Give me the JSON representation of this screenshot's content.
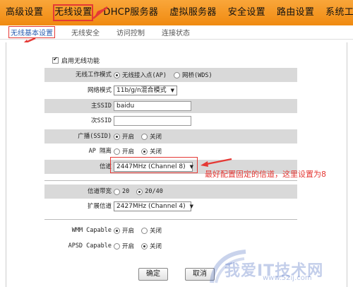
{
  "topnav": {
    "items": [
      "高级设置",
      "无线设置",
      "DHCP服务器",
      "虚拟服务器",
      "安全设置",
      "路由设置",
      "系统工具"
    ]
  },
  "subnav": {
    "tabs": [
      "无线基本设置",
      "无线安全",
      "访问控制",
      "连接状态"
    ]
  },
  "form": {
    "enable_wireless_label": "启用无线功能",
    "enable_wireless_checked": true,
    "mode": {
      "label": "无线工作模式",
      "options": [
        "无线接入点(AP)",
        "网桥(WDS)"
      ],
      "selected": "无线接入点(AP)"
    },
    "network_mode": {
      "label": "网络模式",
      "value": "11b/g/n混合模式"
    },
    "primary_ssid": {
      "label": "主SSID",
      "value": "baidu"
    },
    "secondary_ssid": {
      "label": "次SSID",
      "value": ""
    },
    "broadcast": {
      "label": "广播(SSID)",
      "options": [
        "开启",
        "关闭"
      ],
      "selected": "开启"
    },
    "ap_isolation": {
      "label": "AP 隔离",
      "options": [
        "开启",
        "关闭"
      ],
      "selected": "关闭"
    },
    "channel": {
      "label": "信道",
      "value": "2447MHz (Channel 8)"
    },
    "bandwidth": {
      "label": "信道带宽",
      "options": [
        "20",
        "20/40"
      ],
      "selected": "20/40"
    },
    "ext_channel": {
      "label": "扩展信道",
      "value": "2427MHz (Channel 4)"
    },
    "wmm": {
      "label": "WMM Capable",
      "options": [
        "开启",
        "关闭"
      ],
      "selected": "开启"
    },
    "apsd": {
      "label": "APSD Capable",
      "options": [
        "开启",
        "关闭"
      ],
      "selected": "关闭"
    }
  },
  "buttons": {
    "ok": "确定",
    "cancel": "取消"
  },
  "annotation": "最好配置固定的信道，这里设置为8",
  "watermark": {
    "main": "我爱IT技术网",
    "url": "www.52ij.com"
  },
  "colors": {
    "nav": "#f39c1f",
    "highlight": "#e53935",
    "row_grey": "#d9d9d9"
  }
}
